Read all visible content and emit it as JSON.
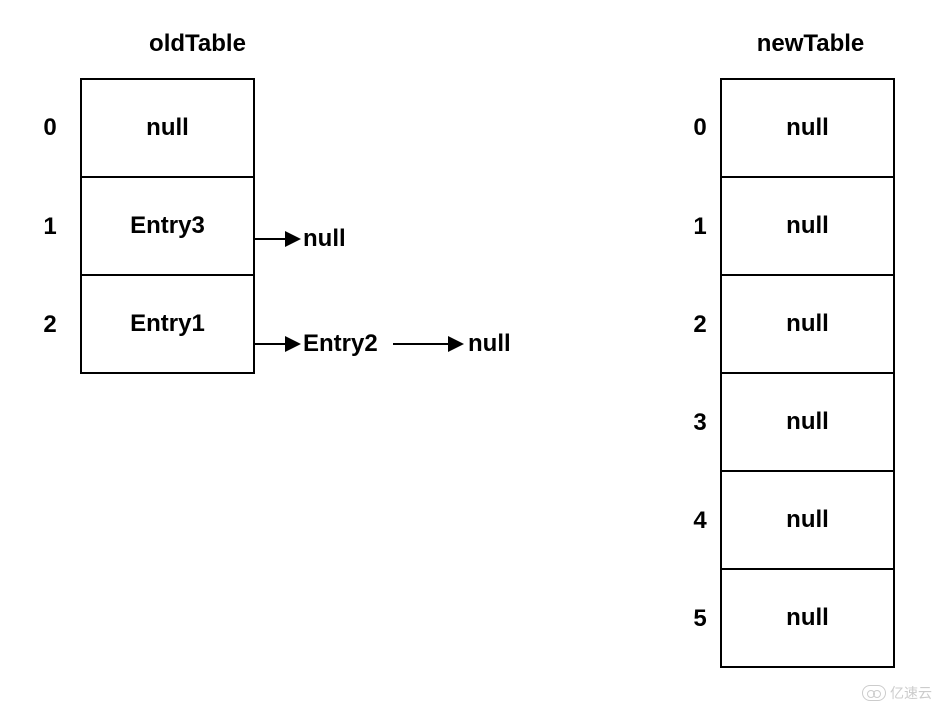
{
  "oldTable": {
    "title": "oldTable",
    "rows": [
      {
        "index": "0",
        "value": "null",
        "chain": []
      },
      {
        "index": "1",
        "value": "Entry3",
        "chain": [
          "null"
        ]
      },
      {
        "index": "2",
        "value": "Entry1",
        "chain": [
          "Entry2",
          "null"
        ]
      }
    ]
  },
  "newTable": {
    "title": "newTable",
    "rows": [
      {
        "index": "0",
        "value": "null"
      },
      {
        "index": "1",
        "value": "null"
      },
      {
        "index": "2",
        "value": "null"
      },
      {
        "index": "3",
        "value": "null"
      },
      {
        "index": "4",
        "value": "null"
      },
      {
        "index": "5",
        "value": "null"
      }
    ]
  },
  "watermark": "亿速云"
}
